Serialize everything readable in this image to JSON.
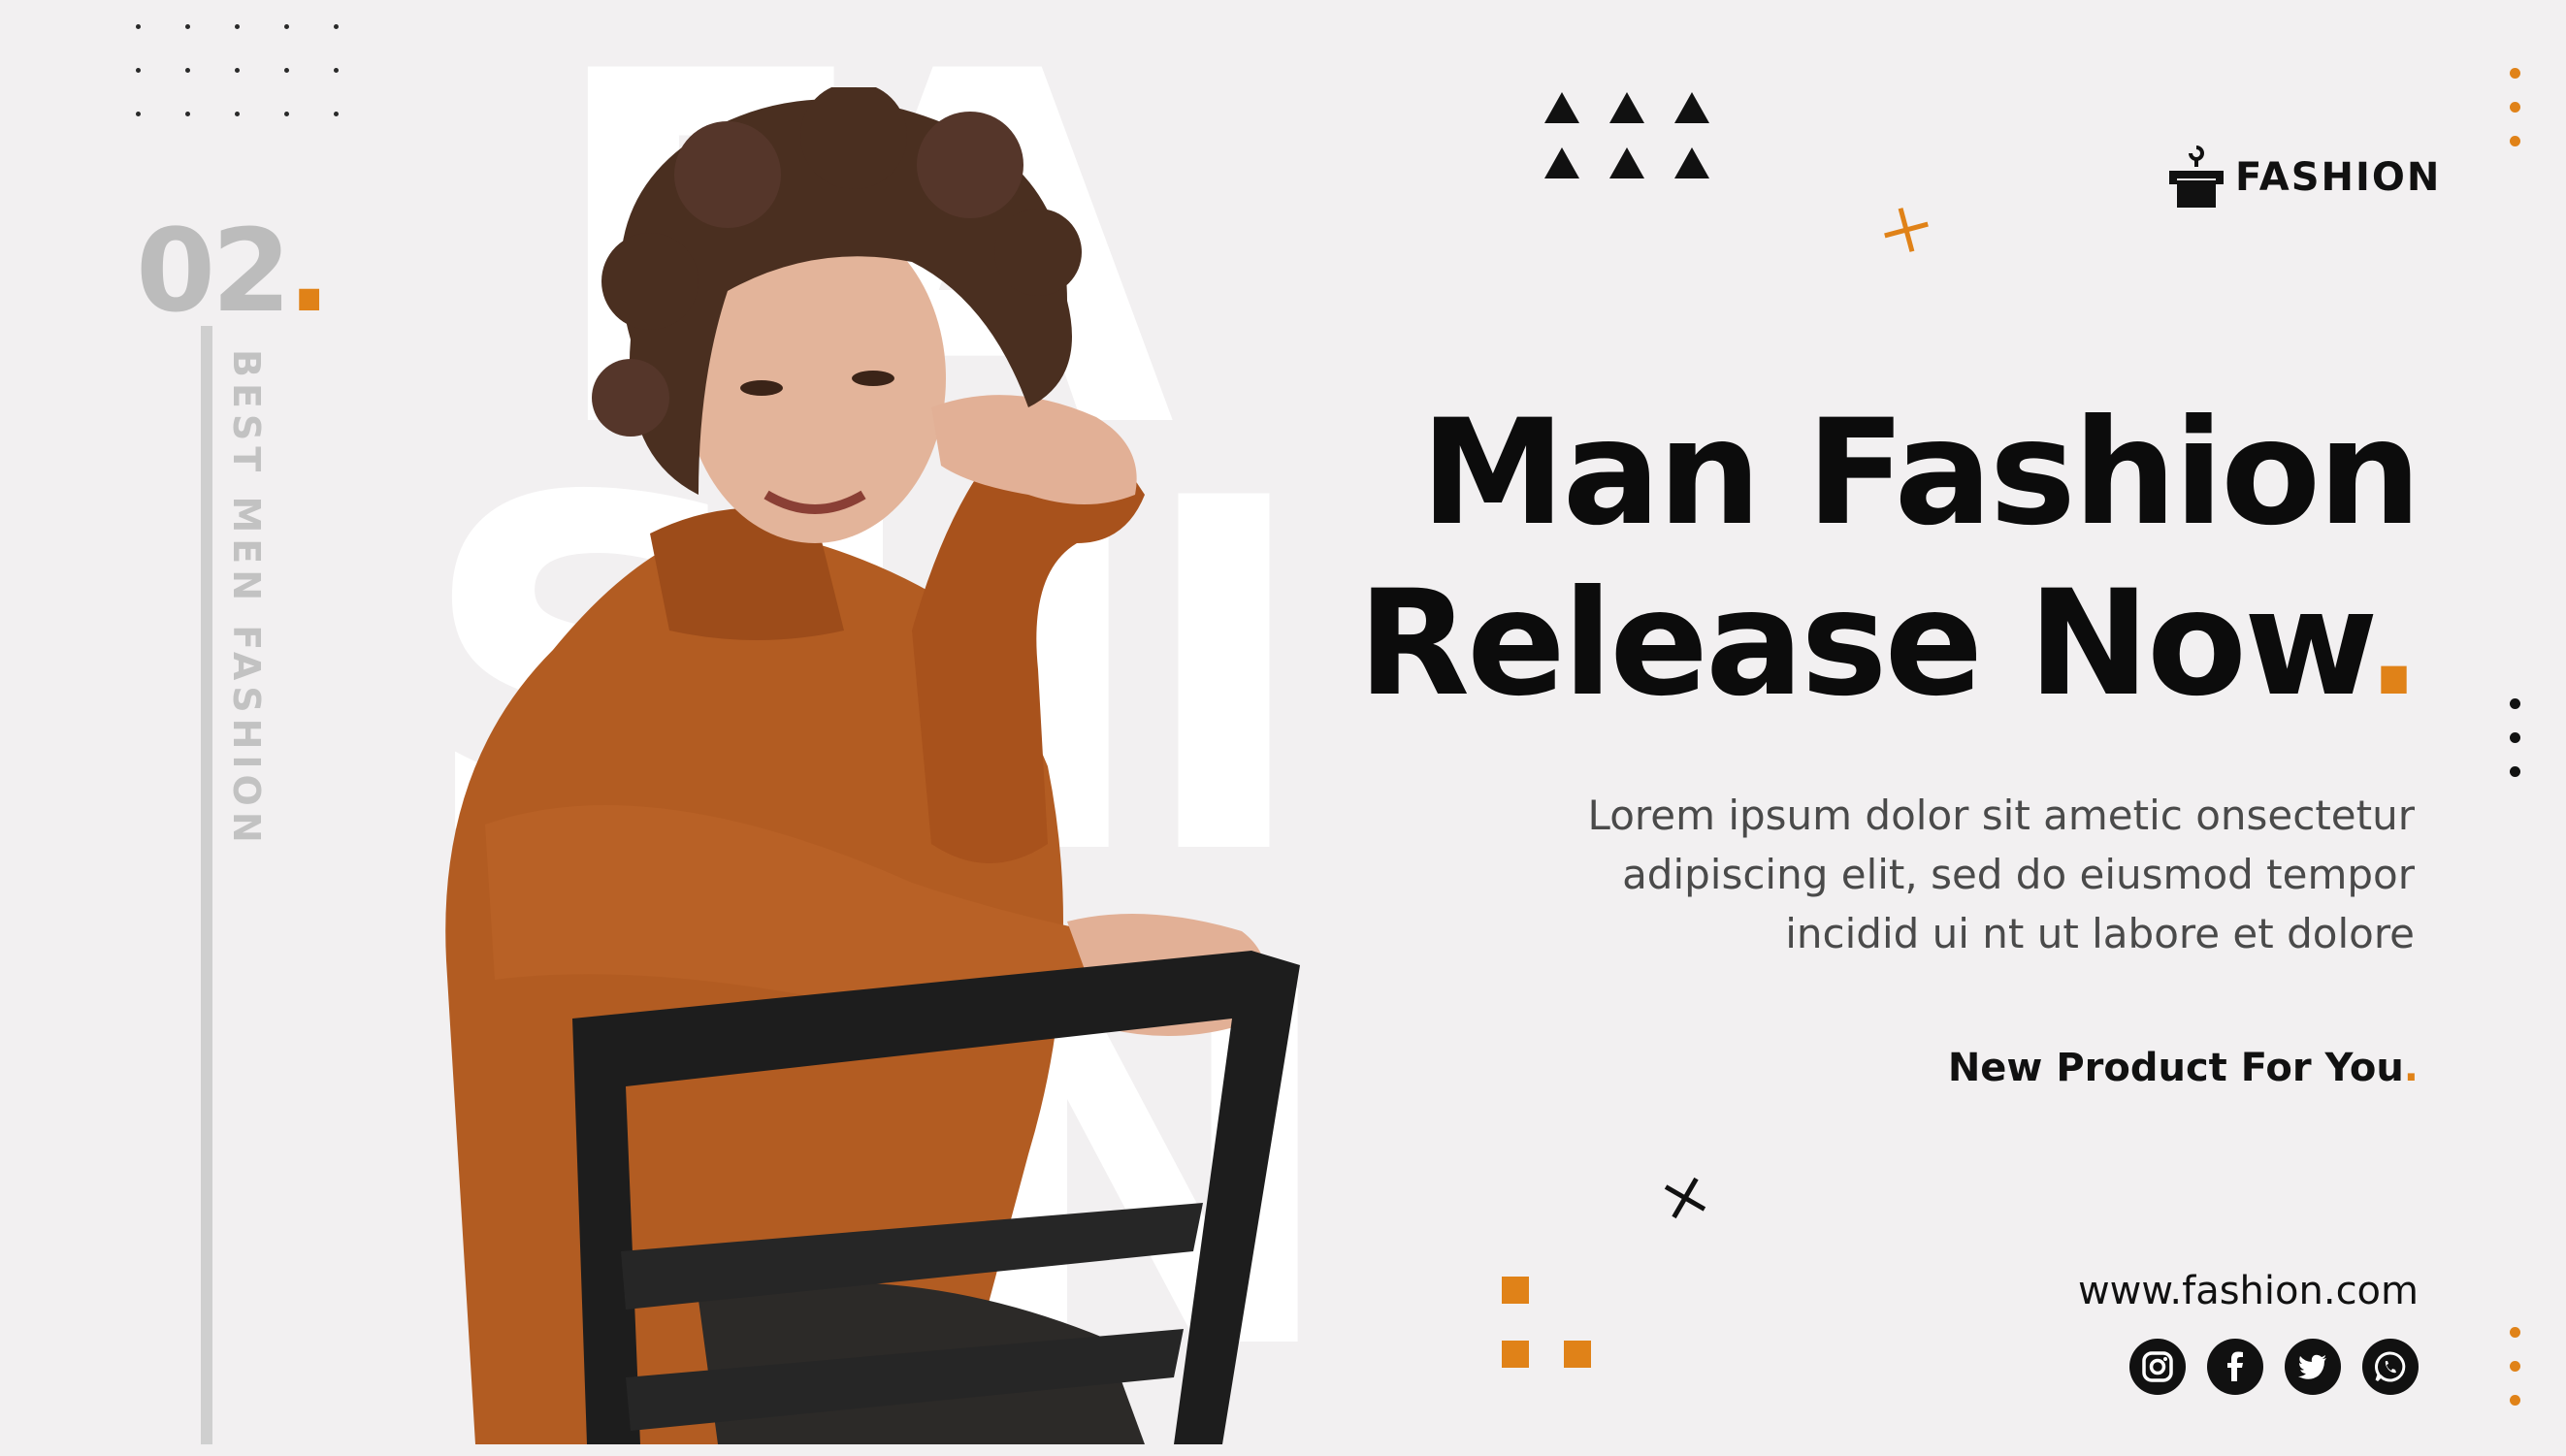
{
  "slide_number": "02",
  "slide_number_dot": ".",
  "vertical_label": "BEST MEN FASHION",
  "watermark_letters": [
    "FA",
    "SHI",
    "ON"
  ],
  "brand": {
    "name": "FASHION",
    "icon": "shopping-bag-icon"
  },
  "headline": {
    "line1": "Man Fashion",
    "line2": "Release Now",
    "dot": "."
  },
  "body": [
    "Lorem ipsum dolor sit ametic onsectetur",
    "adipiscing elit, sed do eiusmod tempor",
    "incidid ui nt ut labore et dolore"
  ],
  "tagline": {
    "text": "New Product For You",
    "dot": "."
  },
  "website": "www.fashion.com",
  "social": [
    "instagram-icon",
    "facebook-icon",
    "twitter-icon",
    "whatsapp-icon"
  ],
  "colors": {
    "accent": "#e08218",
    "text": "#0c0c0c",
    "background": "#f2f0f1",
    "muted": "#bcbcbc"
  }
}
